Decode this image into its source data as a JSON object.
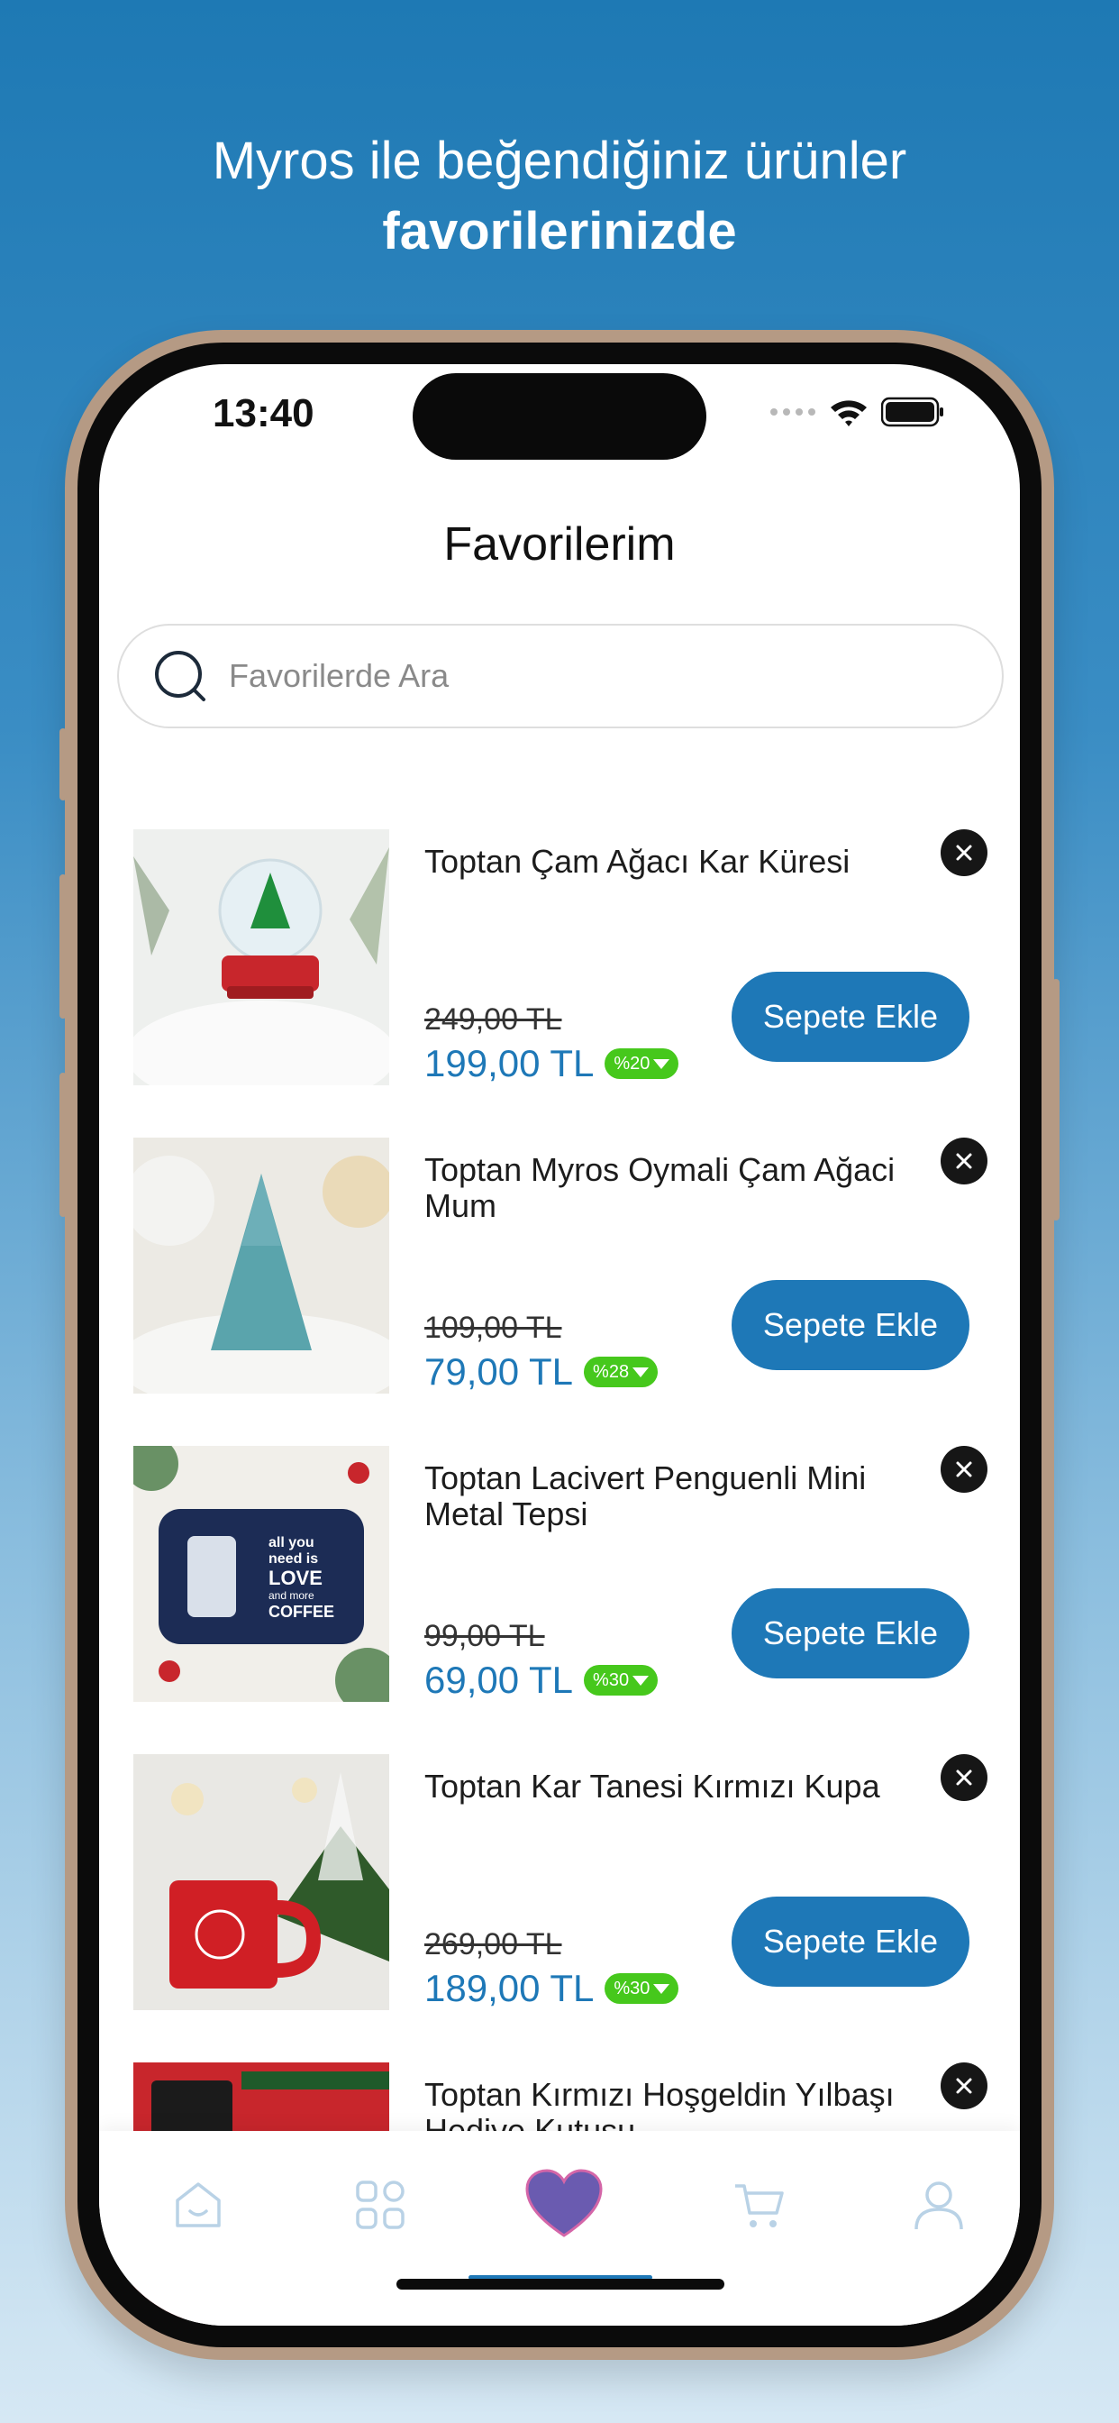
{
  "headline": {
    "line1": "Myros ile beğendiğiniz ürünler",
    "line2": "favorilerinizde"
  },
  "status_bar": {
    "time": "13:40",
    "icons": [
      "signal-dots-icon",
      "wifi-icon",
      "battery-icon"
    ]
  },
  "page": {
    "title": "Favorilerim"
  },
  "search": {
    "placeholder": "Favorilerde Ara",
    "value": ""
  },
  "colors": {
    "accent": "#1e78b7",
    "discount_badge": "#46c81c",
    "background_top": "#1e79b4",
    "heart": "#6a5bb0"
  },
  "items": [
    {
      "name": "Toptan Çam Ağacı Kar Küresi",
      "old_price": "249,00 TL",
      "price": "199,00 TL",
      "discount": "%20",
      "button": "Sepete Ekle",
      "image": "snow-globe-image"
    },
    {
      "name": "Toptan Myros Oymali Çam Ağaci Mum",
      "old_price": "109,00 TL",
      "price": "79,00 TL",
      "discount": "%28",
      "button": "Sepete Ekle",
      "image": "tree-candle-image"
    },
    {
      "name": "Toptan Lacivert Penguenli Mini Metal Tepsi",
      "old_price": "99,00 TL",
      "price": "69,00 TL",
      "discount": "%30",
      "button": "Sepete Ekle",
      "image": "penguin-tray-image",
      "tray_text": [
        "all you",
        "need is",
        "LOVE",
        "and more",
        "COFFEE"
      ]
    },
    {
      "name": "Toptan Kar Tanesi Kırmızı Kupa",
      "old_price": "269,00 TL",
      "price": "189,00 TL",
      "discount": "%30",
      "button": "Sepete Ekle",
      "image": "red-mug-image"
    },
    {
      "name": "Toptan Kırmızı Hoşgeldin Yılbaşı Hediye Kutusu",
      "image": "gift-box-image"
    }
  ],
  "tabbar": {
    "tabs": [
      {
        "name": "home",
        "icon": "home-icon",
        "active": false
      },
      {
        "name": "categories",
        "icon": "grid-icon",
        "active": false
      },
      {
        "name": "favorites",
        "icon": "heart-icon",
        "active": true
      },
      {
        "name": "cart",
        "icon": "cart-icon",
        "active": false
      },
      {
        "name": "profile",
        "icon": "user-icon",
        "active": false
      }
    ]
  }
}
